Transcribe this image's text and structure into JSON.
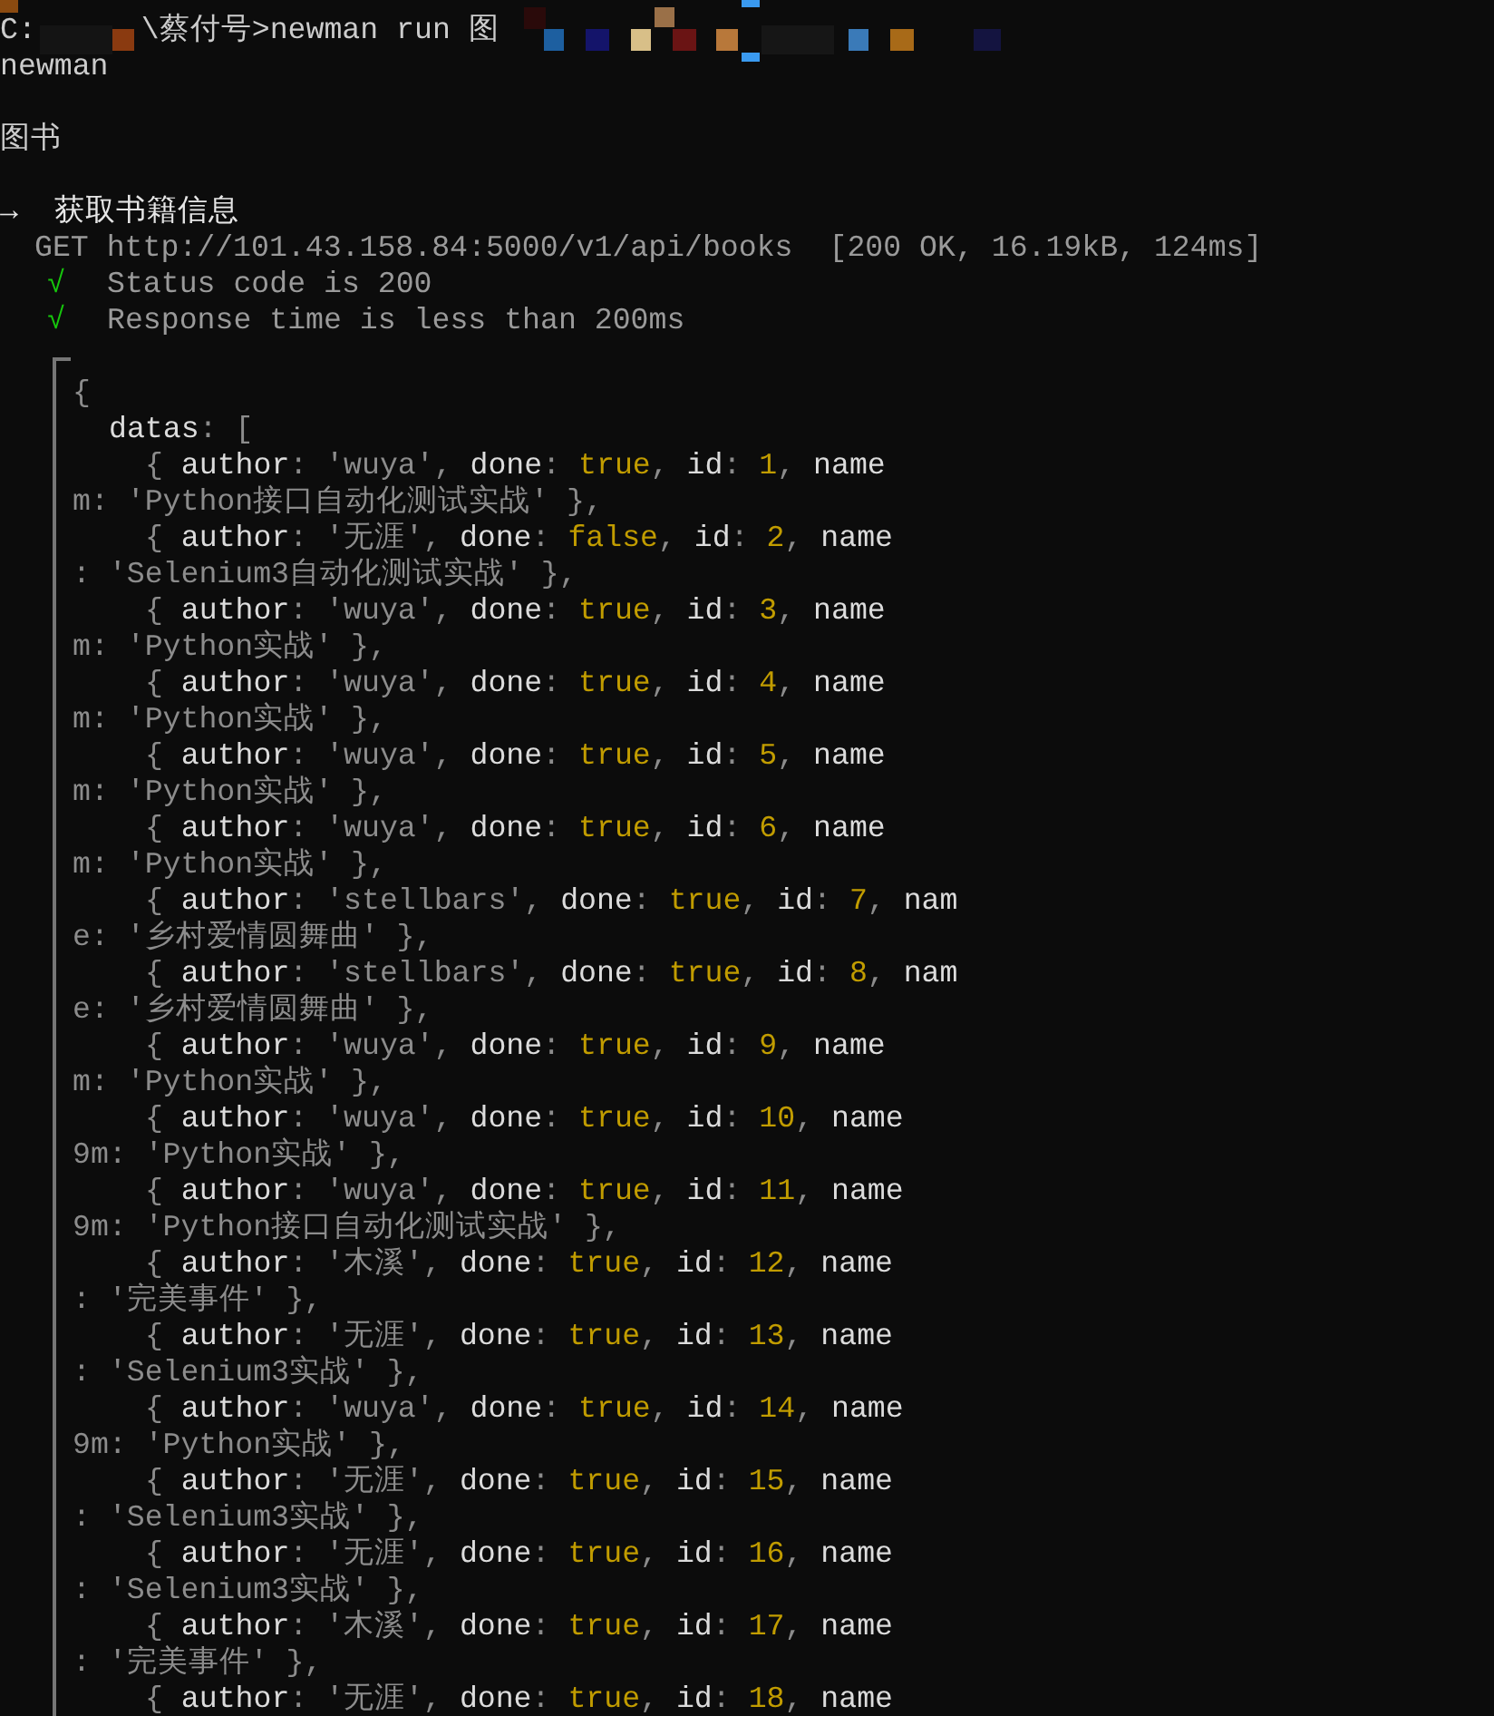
{
  "prompt_line": {
    "drive": "C:",
    "command": "\\蔡付号>newman run 图"
  },
  "collection_name": "newman",
  "folder": "图书",
  "request": {
    "arrow": "→",
    "name": "获取书籍信息",
    "request_line": "GET http://101.43.158.84:5000/v1/api/books",
    "summary": "[200 OK, 16.19kB, 124ms]"
  },
  "assertions": [
    {
      "mark": "√",
      "text": "Status code is 200",
      "passed": true
    },
    {
      "mark": "√",
      "text": "Response time is less than 200ms",
      "passed": true
    }
  ],
  "body_lines": [
    {
      "kind": "brace",
      "segs": [
        {
          "text": "{",
          "kind": "punct"
        }
      ]
    },
    {
      "kind": "key",
      "segs": [
        {
          "text": "datas",
          "kind": "key"
        },
        {
          "text": ": [",
          "kind": "punct"
        }
      ]
    },
    {
      "kind": "item",
      "segs": [
        {
          "text": "{ ",
          "kind": "punct"
        },
        {
          "text": "author",
          "kind": "key"
        },
        {
          "text": ": ",
          "kind": "punct"
        },
        {
          "text": "'wuya'",
          "kind": "string"
        },
        {
          "text": ", ",
          "kind": "punct"
        },
        {
          "text": "done",
          "kind": "key"
        },
        {
          "text": ": ",
          "kind": "punct"
        },
        {
          "text": "true",
          "kind": "literal"
        },
        {
          "text": ", ",
          "kind": "punct"
        },
        {
          "text": "id",
          "kind": "key"
        },
        {
          "text": ": ",
          "kind": "punct"
        },
        {
          "text": "1",
          "kind": "literal"
        },
        {
          "text": ", ",
          "kind": "punct"
        },
        {
          "text": "name",
          "kind": "key"
        }
      ]
    },
    {
      "kind": "cont",
      "segs": [
        {
          "text": "m: 'Python接口自动化测试实战' },",
          "kind": "string"
        }
      ]
    },
    {
      "kind": "item",
      "segs": [
        {
          "text": "{ ",
          "kind": "punct"
        },
        {
          "text": "author",
          "kind": "key"
        },
        {
          "text": ": ",
          "kind": "punct"
        },
        {
          "text": "'无涯'",
          "kind": "string"
        },
        {
          "text": ", ",
          "kind": "punct"
        },
        {
          "text": "done",
          "kind": "key"
        },
        {
          "text": ": ",
          "kind": "punct"
        },
        {
          "text": "false",
          "kind": "literal"
        },
        {
          "text": ", ",
          "kind": "punct"
        },
        {
          "text": "id",
          "kind": "key"
        },
        {
          "text": ": ",
          "kind": "punct"
        },
        {
          "text": "2",
          "kind": "literal"
        },
        {
          "text": ", ",
          "kind": "punct"
        },
        {
          "text": "name",
          "kind": "key"
        }
      ]
    },
    {
      "kind": "cont",
      "segs": [
        {
          "text": ": 'Selenium3自动化测试实战' },",
          "kind": "string"
        }
      ]
    },
    {
      "kind": "item",
      "segs": [
        {
          "text": "{ ",
          "kind": "punct"
        },
        {
          "text": "author",
          "kind": "key"
        },
        {
          "text": ": ",
          "kind": "punct"
        },
        {
          "text": "'wuya'",
          "kind": "string"
        },
        {
          "text": ", ",
          "kind": "punct"
        },
        {
          "text": "done",
          "kind": "key"
        },
        {
          "text": ": ",
          "kind": "punct"
        },
        {
          "text": "true",
          "kind": "literal"
        },
        {
          "text": ", ",
          "kind": "punct"
        },
        {
          "text": "id",
          "kind": "key"
        },
        {
          "text": ": ",
          "kind": "punct"
        },
        {
          "text": "3",
          "kind": "literal"
        },
        {
          "text": ", ",
          "kind": "punct"
        },
        {
          "text": "name",
          "kind": "key"
        }
      ]
    },
    {
      "kind": "cont",
      "segs": [
        {
          "text": "m: 'Python实战' },",
          "kind": "string"
        }
      ]
    },
    {
      "kind": "item",
      "segs": [
        {
          "text": "{ ",
          "kind": "punct"
        },
        {
          "text": "author",
          "kind": "key"
        },
        {
          "text": ": ",
          "kind": "punct"
        },
        {
          "text": "'wuya'",
          "kind": "string"
        },
        {
          "text": ", ",
          "kind": "punct"
        },
        {
          "text": "done",
          "kind": "key"
        },
        {
          "text": ": ",
          "kind": "punct"
        },
        {
          "text": "true",
          "kind": "literal"
        },
        {
          "text": ", ",
          "kind": "punct"
        },
        {
          "text": "id",
          "kind": "key"
        },
        {
          "text": ": ",
          "kind": "punct"
        },
        {
          "text": "4",
          "kind": "literal"
        },
        {
          "text": ", ",
          "kind": "punct"
        },
        {
          "text": "name",
          "kind": "key"
        }
      ]
    },
    {
      "kind": "cont",
      "segs": [
        {
          "text": "m: 'Python实战' },",
          "kind": "string"
        }
      ]
    },
    {
      "kind": "item",
      "segs": [
        {
          "text": "{ ",
          "kind": "punct"
        },
        {
          "text": "author",
          "kind": "key"
        },
        {
          "text": ": ",
          "kind": "punct"
        },
        {
          "text": "'wuya'",
          "kind": "string"
        },
        {
          "text": ", ",
          "kind": "punct"
        },
        {
          "text": "done",
          "kind": "key"
        },
        {
          "text": ": ",
          "kind": "punct"
        },
        {
          "text": "true",
          "kind": "literal"
        },
        {
          "text": ", ",
          "kind": "punct"
        },
        {
          "text": "id",
          "kind": "key"
        },
        {
          "text": ": ",
          "kind": "punct"
        },
        {
          "text": "5",
          "kind": "literal"
        },
        {
          "text": ", ",
          "kind": "punct"
        },
        {
          "text": "name",
          "kind": "key"
        }
      ]
    },
    {
      "kind": "cont",
      "segs": [
        {
          "text": "m: 'Python实战' },",
          "kind": "string"
        }
      ]
    },
    {
      "kind": "item",
      "segs": [
        {
          "text": "{ ",
          "kind": "punct"
        },
        {
          "text": "author",
          "kind": "key"
        },
        {
          "text": ": ",
          "kind": "punct"
        },
        {
          "text": "'wuya'",
          "kind": "string"
        },
        {
          "text": ", ",
          "kind": "punct"
        },
        {
          "text": "done",
          "kind": "key"
        },
        {
          "text": ": ",
          "kind": "punct"
        },
        {
          "text": "true",
          "kind": "literal"
        },
        {
          "text": ", ",
          "kind": "punct"
        },
        {
          "text": "id",
          "kind": "key"
        },
        {
          "text": ": ",
          "kind": "punct"
        },
        {
          "text": "6",
          "kind": "literal"
        },
        {
          "text": ", ",
          "kind": "punct"
        },
        {
          "text": "name",
          "kind": "key"
        }
      ]
    },
    {
      "kind": "cont",
      "segs": [
        {
          "text": "m: 'Python实战' },",
          "kind": "string"
        }
      ]
    },
    {
      "kind": "item",
      "segs": [
        {
          "text": "{ ",
          "kind": "punct"
        },
        {
          "text": "author",
          "kind": "key"
        },
        {
          "text": ": ",
          "kind": "punct"
        },
        {
          "text": "'stellbars'",
          "kind": "string"
        },
        {
          "text": ", ",
          "kind": "punct"
        },
        {
          "text": "done",
          "kind": "key"
        },
        {
          "text": ": ",
          "kind": "punct"
        },
        {
          "text": "true",
          "kind": "literal"
        },
        {
          "text": ", ",
          "kind": "punct"
        },
        {
          "text": "id",
          "kind": "key"
        },
        {
          "text": ": ",
          "kind": "punct"
        },
        {
          "text": "7",
          "kind": "literal"
        },
        {
          "text": ", ",
          "kind": "punct"
        },
        {
          "text": "nam",
          "kind": "key"
        }
      ]
    },
    {
      "kind": "cont",
      "segs": [
        {
          "text": "e: '乡村爱情圆舞曲' },",
          "kind": "string"
        }
      ]
    },
    {
      "kind": "item",
      "segs": [
        {
          "text": "{ ",
          "kind": "punct"
        },
        {
          "text": "author",
          "kind": "key"
        },
        {
          "text": ": ",
          "kind": "punct"
        },
        {
          "text": "'stellbars'",
          "kind": "string"
        },
        {
          "text": ", ",
          "kind": "punct"
        },
        {
          "text": "done",
          "kind": "key"
        },
        {
          "text": ": ",
          "kind": "punct"
        },
        {
          "text": "true",
          "kind": "literal"
        },
        {
          "text": ", ",
          "kind": "punct"
        },
        {
          "text": "id",
          "kind": "key"
        },
        {
          "text": ": ",
          "kind": "punct"
        },
        {
          "text": "8",
          "kind": "literal"
        },
        {
          "text": ", ",
          "kind": "punct"
        },
        {
          "text": "nam",
          "kind": "key"
        }
      ]
    },
    {
      "kind": "cont",
      "segs": [
        {
          "text": "e: '乡村爱情圆舞曲' },",
          "kind": "string"
        }
      ]
    },
    {
      "kind": "item",
      "segs": [
        {
          "text": "{ ",
          "kind": "punct"
        },
        {
          "text": "author",
          "kind": "key"
        },
        {
          "text": ": ",
          "kind": "punct"
        },
        {
          "text": "'wuya'",
          "kind": "string"
        },
        {
          "text": ", ",
          "kind": "punct"
        },
        {
          "text": "done",
          "kind": "key"
        },
        {
          "text": ": ",
          "kind": "punct"
        },
        {
          "text": "true",
          "kind": "literal"
        },
        {
          "text": ", ",
          "kind": "punct"
        },
        {
          "text": "id",
          "kind": "key"
        },
        {
          "text": ": ",
          "kind": "punct"
        },
        {
          "text": "9",
          "kind": "literal"
        },
        {
          "text": ", ",
          "kind": "punct"
        },
        {
          "text": "name",
          "kind": "key"
        }
      ]
    },
    {
      "kind": "cont",
      "segs": [
        {
          "text": "m: 'Python实战' },",
          "kind": "string"
        }
      ]
    },
    {
      "kind": "item",
      "segs": [
        {
          "text": "{ ",
          "kind": "punct"
        },
        {
          "text": "author",
          "kind": "key"
        },
        {
          "text": ": ",
          "kind": "punct"
        },
        {
          "text": "'wuya'",
          "kind": "string"
        },
        {
          "text": ", ",
          "kind": "punct"
        },
        {
          "text": "done",
          "kind": "key"
        },
        {
          "text": ": ",
          "kind": "punct"
        },
        {
          "text": "true",
          "kind": "literal"
        },
        {
          "text": ", ",
          "kind": "punct"
        },
        {
          "text": "id",
          "kind": "key"
        },
        {
          "text": ": ",
          "kind": "punct"
        },
        {
          "text": "10",
          "kind": "literal"
        },
        {
          "text": ", ",
          "kind": "punct"
        },
        {
          "text": "name",
          "kind": "key"
        }
      ]
    },
    {
      "kind": "cont",
      "segs": [
        {
          "text": "9m: 'Python实战' },",
          "kind": "string"
        }
      ]
    },
    {
      "kind": "item",
      "segs": [
        {
          "text": "{ ",
          "kind": "punct"
        },
        {
          "text": "author",
          "kind": "key"
        },
        {
          "text": ": ",
          "kind": "punct"
        },
        {
          "text": "'wuya'",
          "kind": "string"
        },
        {
          "text": ", ",
          "kind": "punct"
        },
        {
          "text": "done",
          "kind": "key"
        },
        {
          "text": ": ",
          "kind": "punct"
        },
        {
          "text": "true",
          "kind": "literal"
        },
        {
          "text": ", ",
          "kind": "punct"
        },
        {
          "text": "id",
          "kind": "key"
        },
        {
          "text": ": ",
          "kind": "punct"
        },
        {
          "text": "11",
          "kind": "literal"
        },
        {
          "text": ", ",
          "kind": "punct"
        },
        {
          "text": "name",
          "kind": "key"
        }
      ]
    },
    {
      "kind": "cont",
      "segs": [
        {
          "text": "9m: 'Python接口自动化测试实战' },",
          "kind": "string"
        }
      ]
    },
    {
      "kind": "item",
      "segs": [
        {
          "text": "{ ",
          "kind": "punct"
        },
        {
          "text": "author",
          "kind": "key"
        },
        {
          "text": ": ",
          "kind": "punct"
        },
        {
          "text": "'木溪'",
          "kind": "string"
        },
        {
          "text": ", ",
          "kind": "punct"
        },
        {
          "text": "done",
          "kind": "key"
        },
        {
          "text": ": ",
          "kind": "punct"
        },
        {
          "text": "true",
          "kind": "literal"
        },
        {
          "text": ", ",
          "kind": "punct"
        },
        {
          "text": "id",
          "kind": "key"
        },
        {
          "text": ": ",
          "kind": "punct"
        },
        {
          "text": "12",
          "kind": "literal"
        },
        {
          "text": ", ",
          "kind": "punct"
        },
        {
          "text": "name",
          "kind": "key"
        }
      ]
    },
    {
      "kind": "cont",
      "segs": [
        {
          "text": ": '完美事件' },",
          "kind": "string"
        }
      ]
    },
    {
      "kind": "item",
      "segs": [
        {
          "text": "{ ",
          "kind": "punct"
        },
        {
          "text": "author",
          "kind": "key"
        },
        {
          "text": ": ",
          "kind": "punct"
        },
        {
          "text": "'无涯'",
          "kind": "string"
        },
        {
          "text": ", ",
          "kind": "punct"
        },
        {
          "text": "done",
          "kind": "key"
        },
        {
          "text": ": ",
          "kind": "punct"
        },
        {
          "text": "true",
          "kind": "literal"
        },
        {
          "text": ", ",
          "kind": "punct"
        },
        {
          "text": "id",
          "kind": "key"
        },
        {
          "text": ": ",
          "kind": "punct"
        },
        {
          "text": "13",
          "kind": "literal"
        },
        {
          "text": ", ",
          "kind": "punct"
        },
        {
          "text": "name",
          "kind": "key"
        }
      ]
    },
    {
      "kind": "cont",
      "segs": [
        {
          "text": ": 'Selenium3实战' },",
          "kind": "string"
        }
      ]
    },
    {
      "kind": "item",
      "segs": [
        {
          "text": "{ ",
          "kind": "punct"
        },
        {
          "text": "author",
          "kind": "key"
        },
        {
          "text": ": ",
          "kind": "punct"
        },
        {
          "text": "'wuya'",
          "kind": "string"
        },
        {
          "text": ", ",
          "kind": "punct"
        },
        {
          "text": "done",
          "kind": "key"
        },
        {
          "text": ": ",
          "kind": "punct"
        },
        {
          "text": "true",
          "kind": "literal"
        },
        {
          "text": ", ",
          "kind": "punct"
        },
        {
          "text": "id",
          "kind": "key"
        },
        {
          "text": ": ",
          "kind": "punct"
        },
        {
          "text": "14",
          "kind": "literal"
        },
        {
          "text": ", ",
          "kind": "punct"
        },
        {
          "text": "name",
          "kind": "key"
        }
      ]
    },
    {
      "kind": "cont",
      "segs": [
        {
          "text": "9m: 'Python实战' },",
          "kind": "string"
        }
      ]
    },
    {
      "kind": "item",
      "segs": [
        {
          "text": "{ ",
          "kind": "punct"
        },
        {
          "text": "author",
          "kind": "key"
        },
        {
          "text": ": ",
          "kind": "punct"
        },
        {
          "text": "'无涯'",
          "kind": "string"
        },
        {
          "text": ", ",
          "kind": "punct"
        },
        {
          "text": "done",
          "kind": "key"
        },
        {
          "text": ": ",
          "kind": "punct"
        },
        {
          "text": "true",
          "kind": "literal"
        },
        {
          "text": ", ",
          "kind": "punct"
        },
        {
          "text": "id",
          "kind": "key"
        },
        {
          "text": ": ",
          "kind": "punct"
        },
        {
          "text": "15",
          "kind": "literal"
        },
        {
          "text": ", ",
          "kind": "punct"
        },
        {
          "text": "name",
          "kind": "key"
        }
      ]
    },
    {
      "kind": "cont",
      "segs": [
        {
          "text": ": 'Selenium3实战' },",
          "kind": "string"
        }
      ]
    },
    {
      "kind": "item",
      "segs": [
        {
          "text": "{ ",
          "kind": "punct"
        },
        {
          "text": "author",
          "kind": "key"
        },
        {
          "text": ": ",
          "kind": "punct"
        },
        {
          "text": "'无涯'",
          "kind": "string"
        },
        {
          "text": ", ",
          "kind": "punct"
        },
        {
          "text": "done",
          "kind": "key"
        },
        {
          "text": ": ",
          "kind": "punct"
        },
        {
          "text": "true",
          "kind": "literal"
        },
        {
          "text": ", ",
          "kind": "punct"
        },
        {
          "text": "id",
          "kind": "key"
        },
        {
          "text": ": ",
          "kind": "punct"
        },
        {
          "text": "16",
          "kind": "literal"
        },
        {
          "text": ", ",
          "kind": "punct"
        },
        {
          "text": "name",
          "kind": "key"
        }
      ]
    },
    {
      "kind": "cont",
      "segs": [
        {
          "text": ": 'Selenium3实战' },",
          "kind": "string"
        }
      ]
    },
    {
      "kind": "item",
      "segs": [
        {
          "text": "{ ",
          "kind": "punct"
        },
        {
          "text": "author",
          "kind": "key"
        },
        {
          "text": ": ",
          "kind": "punct"
        },
        {
          "text": "'木溪'",
          "kind": "string"
        },
        {
          "text": ", ",
          "kind": "punct"
        },
        {
          "text": "done",
          "kind": "key"
        },
        {
          "text": ": ",
          "kind": "punct"
        },
        {
          "text": "true",
          "kind": "literal"
        },
        {
          "text": ", ",
          "kind": "punct"
        },
        {
          "text": "id",
          "kind": "key"
        },
        {
          "text": ": ",
          "kind": "punct"
        },
        {
          "text": "17",
          "kind": "literal"
        },
        {
          "text": ", ",
          "kind": "punct"
        },
        {
          "text": "name",
          "kind": "key"
        }
      ]
    },
    {
      "kind": "cont",
      "segs": [
        {
          "text": ": '完美事件' },",
          "kind": "string"
        }
      ]
    },
    {
      "kind": "item",
      "segs": [
        {
          "text": "{ ",
          "kind": "punct"
        },
        {
          "text": "author",
          "kind": "key"
        },
        {
          "text": ": ",
          "kind": "punct"
        },
        {
          "text": "'无涯'",
          "kind": "string"
        },
        {
          "text": ", ",
          "kind": "punct"
        },
        {
          "text": "done",
          "kind": "key"
        },
        {
          "text": ": ",
          "kind": "punct"
        },
        {
          "text": "true",
          "kind": "literal"
        },
        {
          "text": ", ",
          "kind": "punct"
        },
        {
          "text": "id",
          "kind": "key"
        },
        {
          "text": ": ",
          "kind": "punct"
        },
        {
          "text": "18",
          "kind": "literal"
        },
        {
          "text": ", ",
          "kind": "punct"
        },
        {
          "text": "name",
          "kind": "key"
        }
      ]
    }
  ]
}
